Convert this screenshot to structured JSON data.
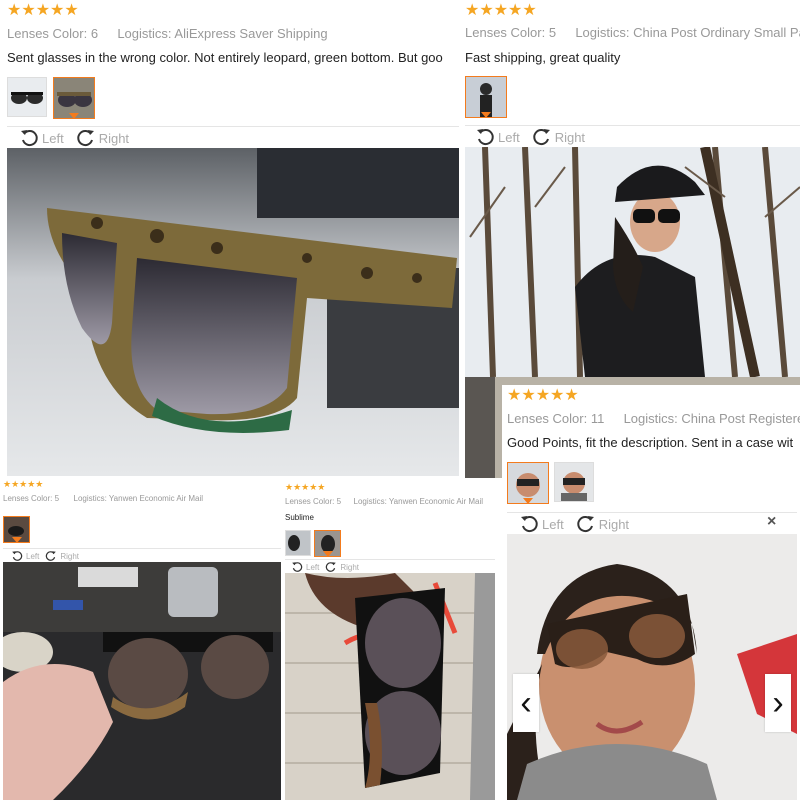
{
  "colors": {
    "star": "#f5a623",
    "accent": "#f37b1d",
    "meta": "#999999"
  },
  "reviews": [
    {
      "stars": "★★★★★",
      "lenses_color": "Lenses Color: 6",
      "logistics": "Logistics: AliExpress Saver Shipping",
      "text": "Sent glasses in the wrong color. Not entirely leopard, green bottom. But goo",
      "rotate_left": "Left",
      "rotate_right": "Right"
    },
    {
      "stars": "★★★★★",
      "lenses_color": "Lenses Color: 5",
      "logistics": "Logistics: China Post Ordinary Small Pac",
      "text": "Fast shipping, great quality",
      "rotate_left": "Left",
      "rotate_right": "Right"
    },
    {
      "stars": "★★★★★",
      "lenses_color": "Lenses Color: 11",
      "logistics": "Logistics: China Post Registered",
      "text": "Good Points, fit the description. Sent in a case wit",
      "rotate_left": "Left",
      "rotate_right": "Right",
      "close": "×",
      "prev": "‹",
      "next": "›"
    },
    {
      "stars": "★★★★★",
      "lenses_color": "Lenses Color: 5",
      "logistics": "Logistics: Yanwen Economic Air Mail",
      "rotate_left": "Left",
      "rotate_right": "Right"
    },
    {
      "stars": "★★★★★",
      "lenses_color": "Lenses Color: 5",
      "logistics": "Logistics: Yanwen Economic Air Mail",
      "text": "Sublime",
      "rotate_left": "Left",
      "rotate_right": "Right"
    }
  ]
}
